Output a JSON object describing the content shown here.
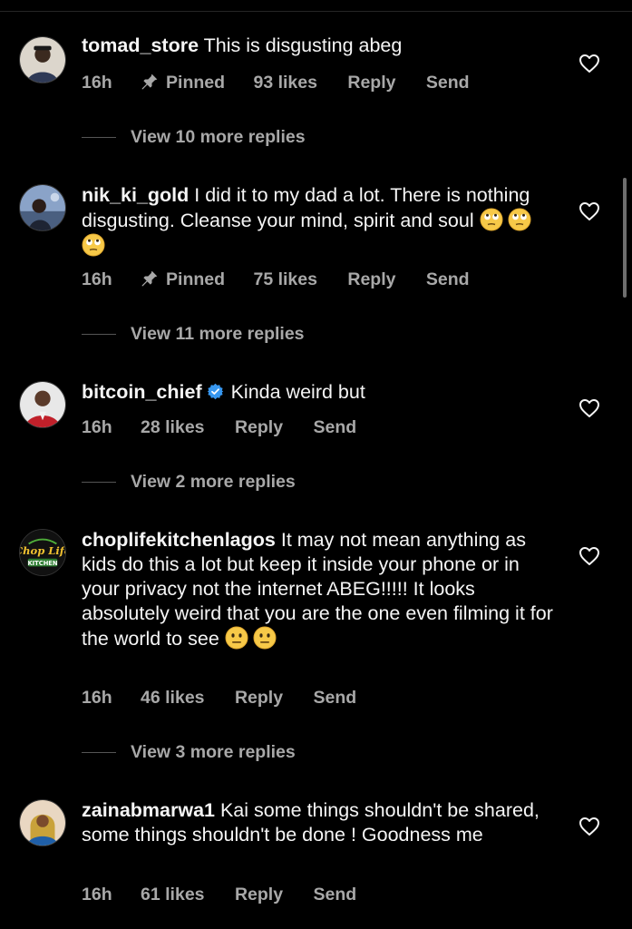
{
  "comments": [
    {
      "username": "tomad_store",
      "text": "This is disgusting abeg",
      "time": "16h",
      "pinned": "Pinned",
      "likes": "93 likes",
      "reply": "Reply",
      "send": "Send",
      "view_replies": "View 10 more replies"
    },
    {
      "username": "nik_ki_gold",
      "text": "I did it to my dad a lot. There is nothing disgusting. Cleanse your mind, spirit and soul",
      "emoji": "🙄🙄🙄",
      "time": "16h",
      "pinned": "Pinned",
      "likes": "75 likes",
      "reply": "Reply",
      "send": "Send",
      "view_replies": "View 11 more replies"
    },
    {
      "username": "bitcoin_chief",
      "text": "Kinda weird but",
      "time": "16h",
      "likes": "28 likes",
      "reply": "Reply",
      "send": "Send",
      "view_replies": "View 2 more replies"
    },
    {
      "username": "choplifekitchenlagos",
      "text": "It may not mean anything as kids do this a lot but keep it inside your phone or in your privacy not the internet ABEG!!!!! It looks absolutely weird that you are the one even filming it for the world to see",
      "emoji": "😐😐",
      "time": "16h",
      "likes": "46 likes",
      "reply": "Reply",
      "send": "Send",
      "view_replies": "View 3 more replies"
    },
    {
      "username": "zainabmarwa1",
      "text": "Kai some things shouldn't be shared, some things shouldn't be done ! Goodness me",
      "time": "16h",
      "likes": "61 likes",
      "reply": "Reply",
      "send": "Send"
    }
  ],
  "avatar_logo_text": "Chop Life KITCHEN",
  "colors": {
    "background": "#000000",
    "text": "#f5f5f5",
    "meta": "#a8a8a8",
    "verified": "#3797f0"
  }
}
